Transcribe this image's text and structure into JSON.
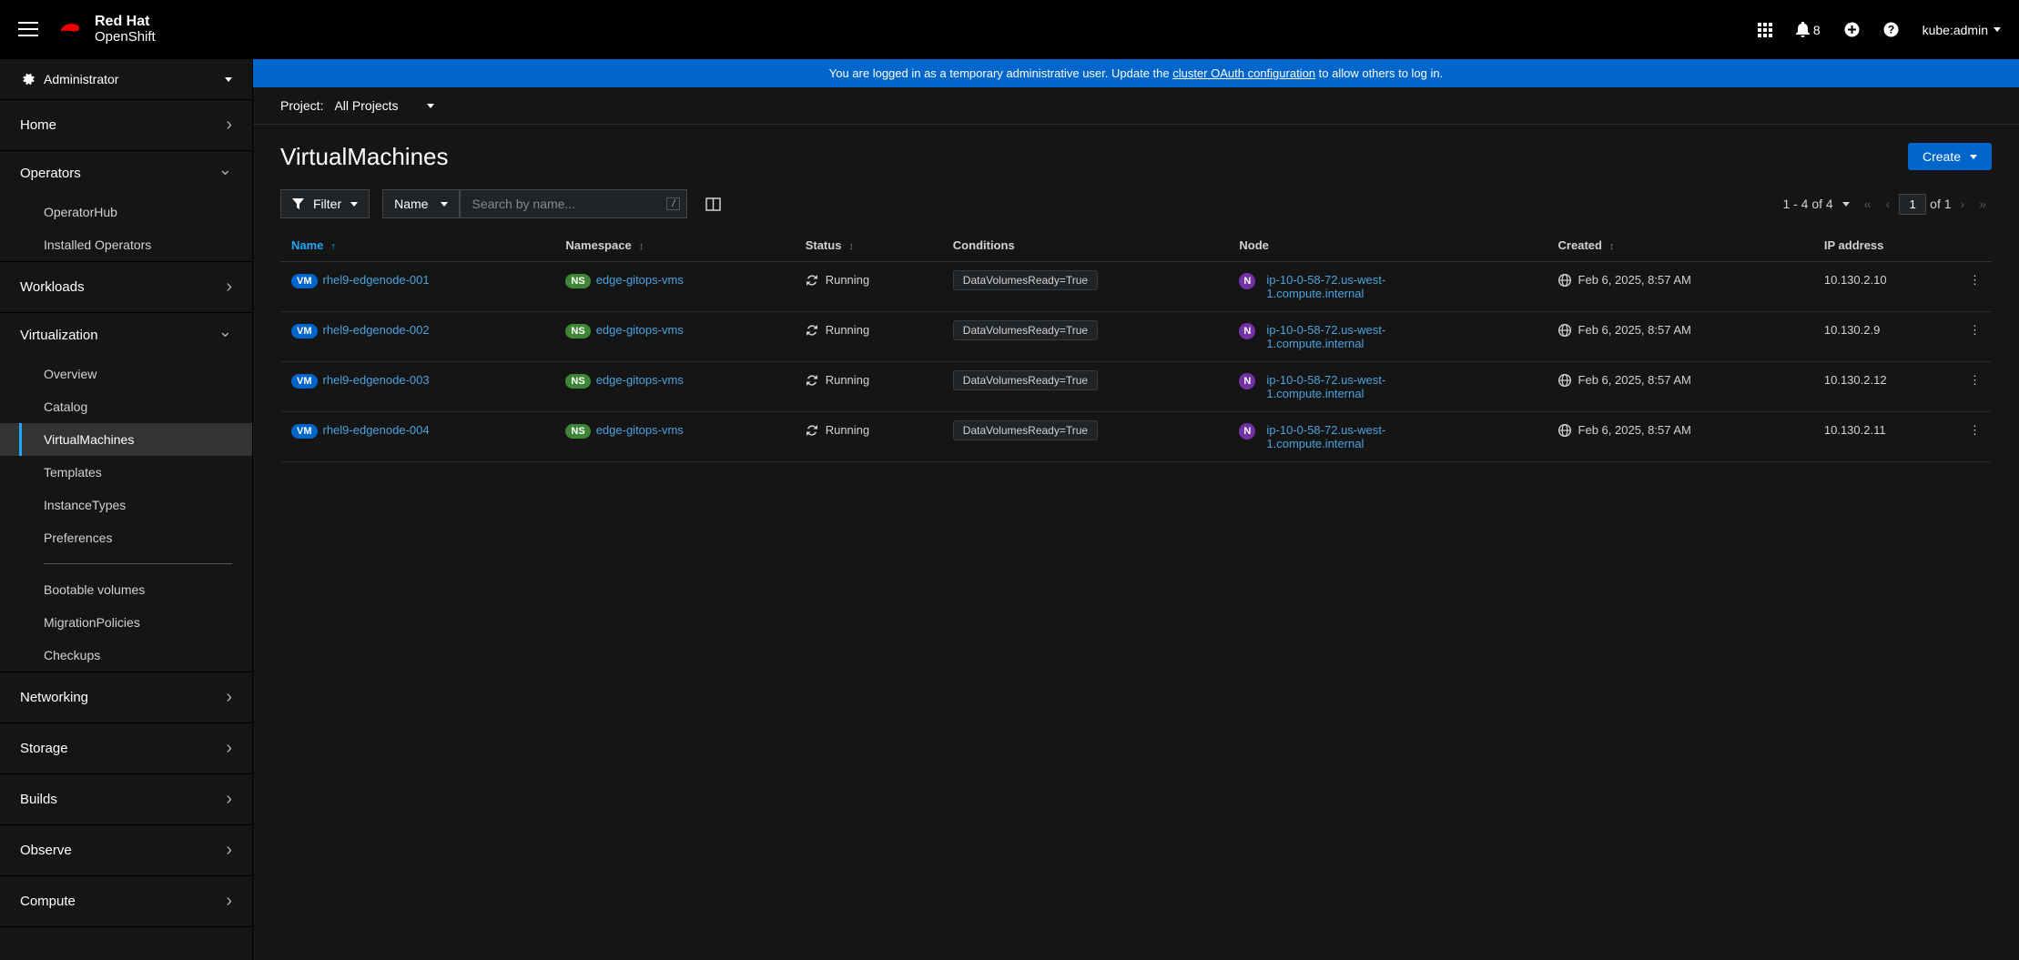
{
  "brand": {
    "line1": "Red Hat",
    "line2": "OpenShift"
  },
  "header": {
    "notification_count": "8",
    "user": "kube:admin"
  },
  "perspective": "Administrator",
  "sidebar": {
    "sections": [
      {
        "label": "Home",
        "open": false,
        "chev": "right",
        "items": []
      },
      {
        "label": "Operators",
        "open": true,
        "chev": "down",
        "items": [
          {
            "label": "OperatorHub"
          },
          {
            "label": "Installed Operators"
          }
        ]
      },
      {
        "label": "Workloads",
        "open": false,
        "chev": "right",
        "items": []
      },
      {
        "label": "Virtualization",
        "open": true,
        "chev": "down",
        "items": [
          {
            "label": "Overview"
          },
          {
            "label": "Catalog"
          },
          {
            "label": "VirtualMachines",
            "selected": true
          },
          {
            "label": "Templates"
          },
          {
            "label": "InstanceTypes"
          },
          {
            "label": "Preferences"
          },
          {
            "divider": true
          },
          {
            "label": "Bootable volumes"
          },
          {
            "label": "MigrationPolicies"
          },
          {
            "label": "Checkups"
          }
        ]
      },
      {
        "label": "Networking",
        "open": false,
        "chev": "right",
        "items": []
      },
      {
        "label": "Storage",
        "open": false,
        "chev": "right",
        "items": []
      },
      {
        "label": "Builds",
        "open": false,
        "chev": "right",
        "items": []
      },
      {
        "label": "Observe",
        "open": false,
        "chev": "right",
        "items": []
      },
      {
        "label": "Compute",
        "open": false,
        "chev": "right",
        "items": []
      }
    ]
  },
  "banner": {
    "pre": "You are logged in as a temporary administrative user. Update the ",
    "link": "cluster OAuth configuration",
    "post": " to allow others to log in."
  },
  "project": {
    "label": "Project:",
    "value": "All Projects"
  },
  "page": {
    "title": "VirtualMachines",
    "create": "Create"
  },
  "toolbar": {
    "filter": "Filter",
    "attr": "Name",
    "search_placeholder": "Search by name...",
    "search_kbd": "/",
    "range": "1 - 4 of 4",
    "page_current": "1",
    "page_of": "of 1"
  },
  "columns": {
    "name": "Name",
    "namespace": "Namespace",
    "status": "Status",
    "conditions": "Conditions",
    "node": "Node",
    "created": "Created",
    "ip": "IP address"
  },
  "rows": [
    {
      "name": "rhel9-edgenode-001",
      "namespace": "edge-gitops-vms",
      "status": "Running",
      "condition": "DataVolumesReady=True",
      "node": "ip-10-0-58-72.us-west-1.compute.internal",
      "created": "Feb 6, 2025, 8:57 AM",
      "ip": "10.130.2.10"
    },
    {
      "name": "rhel9-edgenode-002",
      "namespace": "edge-gitops-vms",
      "status": "Running",
      "condition": "DataVolumesReady=True",
      "node": "ip-10-0-58-72.us-west-1.compute.internal",
      "created": "Feb 6, 2025, 8:57 AM",
      "ip": "10.130.2.9"
    },
    {
      "name": "rhel9-edgenode-003",
      "namespace": "edge-gitops-vms",
      "status": "Running",
      "condition": "DataVolumesReady=True",
      "node": "ip-10-0-58-72.us-west-1.compute.internal",
      "created": "Feb 6, 2025, 8:57 AM",
      "ip": "10.130.2.12"
    },
    {
      "name": "rhel9-edgenode-004",
      "namespace": "edge-gitops-vms",
      "status": "Running",
      "condition": "DataVolumesReady=True",
      "node": "ip-10-0-58-72.us-west-1.compute.internal",
      "created": "Feb 6, 2025, 8:57 AM",
      "ip": "10.130.2.11"
    }
  ],
  "badges": {
    "vm": "VM",
    "ns": "NS",
    "node": "N"
  }
}
